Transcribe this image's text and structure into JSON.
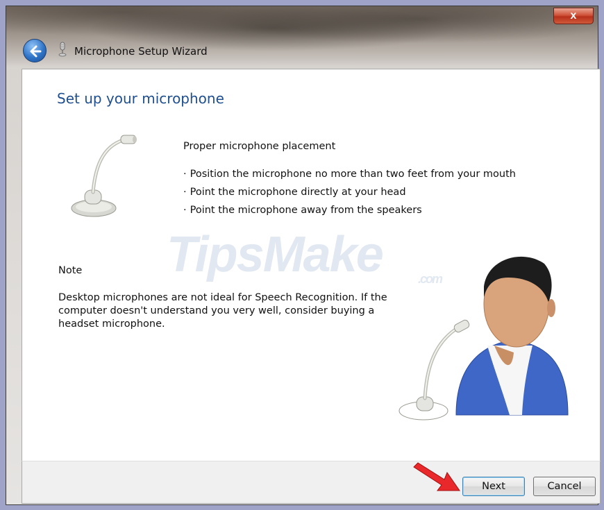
{
  "window": {
    "title": "Microphone Setup Wizard",
    "close_label": "x"
  },
  "content": {
    "heading": "Set up your microphone",
    "placement_title": "Proper microphone placement",
    "bullets": [
      "Position the microphone no more than two feet from your mouth",
      "Point the microphone directly at your head",
      "Point the microphone away from the speakers"
    ],
    "bullet_glyph": "·",
    "note_label": "Note",
    "note_text": "Desktop microphones are not ideal for Speech Recognition. If the computer doesn't understand you very well, consider buying a headset microphone.",
    "watermark": "TipsMake",
    "watermark_suffix": ".com"
  },
  "footer": {
    "next_label": "Next",
    "cancel_label": "Cancel"
  },
  "colors": {
    "heading": "#1f4f8f",
    "close_button": "#c8422a",
    "arrow": "#e8282a",
    "person_shirt": "#3f67c7",
    "person_skin": "#d9a47c"
  },
  "icons": [
    "back-arrow-icon",
    "microphone-icon",
    "desktop-microphone-icon",
    "person-with-microphone-icon",
    "red-arrow-icon"
  ]
}
